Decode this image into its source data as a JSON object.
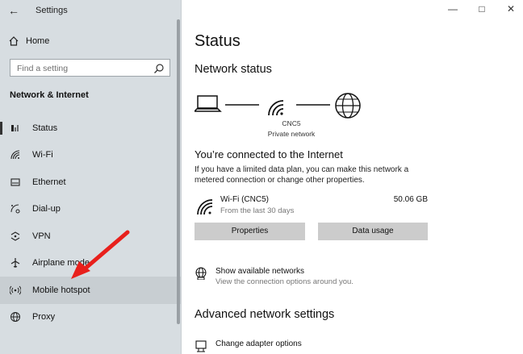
{
  "window": {
    "app_title": "Settings"
  },
  "sidebar": {
    "home_label": "Home",
    "search_placeholder": "Find a setting",
    "section_title": "Network & Internet",
    "items": [
      {
        "label": "Status",
        "icon": "status-icon"
      },
      {
        "label": "Wi-Fi",
        "icon": "wifi-icon"
      },
      {
        "label": "Ethernet",
        "icon": "ethernet-icon"
      },
      {
        "label": "Dial-up",
        "icon": "dialup-icon"
      },
      {
        "label": "VPN",
        "icon": "vpn-icon"
      },
      {
        "label": "Airplane mode",
        "icon": "airplane-icon"
      },
      {
        "label": "Mobile hotspot",
        "icon": "hotspot-icon"
      },
      {
        "label": "Proxy",
        "icon": "globe-icon"
      }
    ]
  },
  "main": {
    "title": "Status",
    "network_status_heading": "Network status",
    "network": {
      "name": "CNC5",
      "type": "Private network"
    },
    "connection_title": "You’re connected to the Internet",
    "connection_desc": "If you have a limited data plan, you can make this network a metered connection or change other properties.",
    "wifi": {
      "name": "Wi-Fi (CNC5)",
      "period": "From the last 30 days",
      "usage": "50.06 GB"
    },
    "buttons": {
      "properties": "Properties",
      "data_usage": "Data usage"
    },
    "show_networks": {
      "title": "Show available networks",
      "subtitle": "View the connection options around you."
    },
    "advanced_heading": "Advanced network settings",
    "change_adapter": {
      "title": "Change adapter options"
    }
  },
  "colors": {
    "sidebar_bg": "#d7dde1",
    "button_bg": "#cccccc",
    "arrow": "#e8201c"
  }
}
